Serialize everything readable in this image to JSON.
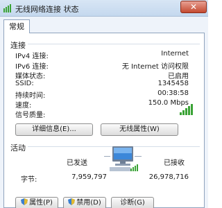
{
  "window": {
    "title": "无线网络连接 状态",
    "close_symbol": "✕",
    "app_icon": "network-status-icon"
  },
  "tabs": [
    {
      "label": "常规"
    }
  ],
  "connection": {
    "section_label": "连接",
    "rows": [
      {
        "label": "IPv4 连接:",
        "value": "Internet"
      },
      {
        "label": "IPv6 连接:",
        "value": "无 Internet 访问权限"
      },
      {
        "label": "媒体状态:",
        "value": "已启用"
      },
      {
        "label": "SSID:",
        "value": "1345458"
      },
      {
        "label": "持续时间:",
        "value": "00:38:58"
      },
      {
        "label": "速度:",
        "value": "150.0 Mbps"
      }
    ],
    "signal_label": "信号质量:",
    "signal_bars_filled": 5,
    "signal_bars_total": 5,
    "details_button": "详细信息(E)...",
    "wireless_props_button": "无线属性(W)"
  },
  "activity": {
    "section_label": "活动",
    "sent_label": "已发送",
    "received_label": "已接收",
    "bytes_label": "字节:",
    "sent_value": "7,959,797",
    "received_value": "26,978,716"
  },
  "footer": {
    "properties_button": "属性(P)",
    "disable_button": "禁用(D)",
    "diagnose_button": "诊断(G)"
  },
  "colors": {
    "signal_green": "#3aa335",
    "title_bg": "#c9dbef",
    "close_red": "#c44a30"
  }
}
